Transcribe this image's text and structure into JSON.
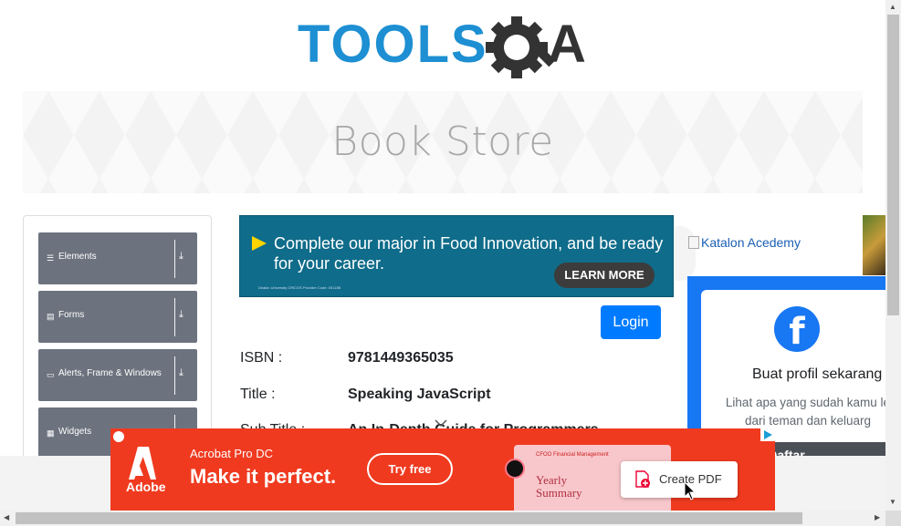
{
  "logo": {
    "text_left": "TOOLS",
    "text_right": "A",
    "colors": {
      "blue": "#1d8fd2",
      "dark": "#333333"
    }
  },
  "banner": {
    "title": "Book Store"
  },
  "sidebar": {
    "groups": [
      {
        "label": "Elements",
        "icon": "hamburger-icon"
      },
      {
        "label": "Forms",
        "icon": "form-icon"
      },
      {
        "label": "Alerts, Frame & Windows",
        "icon": "window-icon"
      },
      {
        "label": "Widgets",
        "icon": "grid-icon"
      }
    ]
  },
  "ads": {
    "food": {
      "text": "Complete our major in Food Innovation, and be ready for your career.",
      "button": "LEARN MORE",
      "fine_print": "Deakin University CRICOS Provider Code: 00113B"
    },
    "right": {
      "alt_text": "Katalon Acedemy",
      "fb_title": "Buat profil sekarang",
      "fb_sub_line1": "Lihat apa yang sudah kamu le",
      "fb_sub_line2": "dari teman dan keluarg",
      "fb_button": "Daftar"
    },
    "adobe": {
      "brand": "Adobe",
      "product": "Acrobat Pro DC",
      "headline": "Make it perfect.",
      "cta": "Try free",
      "doc_header": "CFOO Financial Management",
      "doc_title_line1": "Yearly",
      "doc_title_line2": "Summary",
      "create_label": "Create PDF"
    }
  },
  "login": {
    "label": "Login"
  },
  "book": {
    "isbn_label": "ISBN :",
    "isbn_value": "9781449365035",
    "title_label": "Title :",
    "title_value": "Speaking JavaScript",
    "subtitle_label": "Sub Title :",
    "subtitle_value": "An In-Depth Guide for Programmers"
  }
}
